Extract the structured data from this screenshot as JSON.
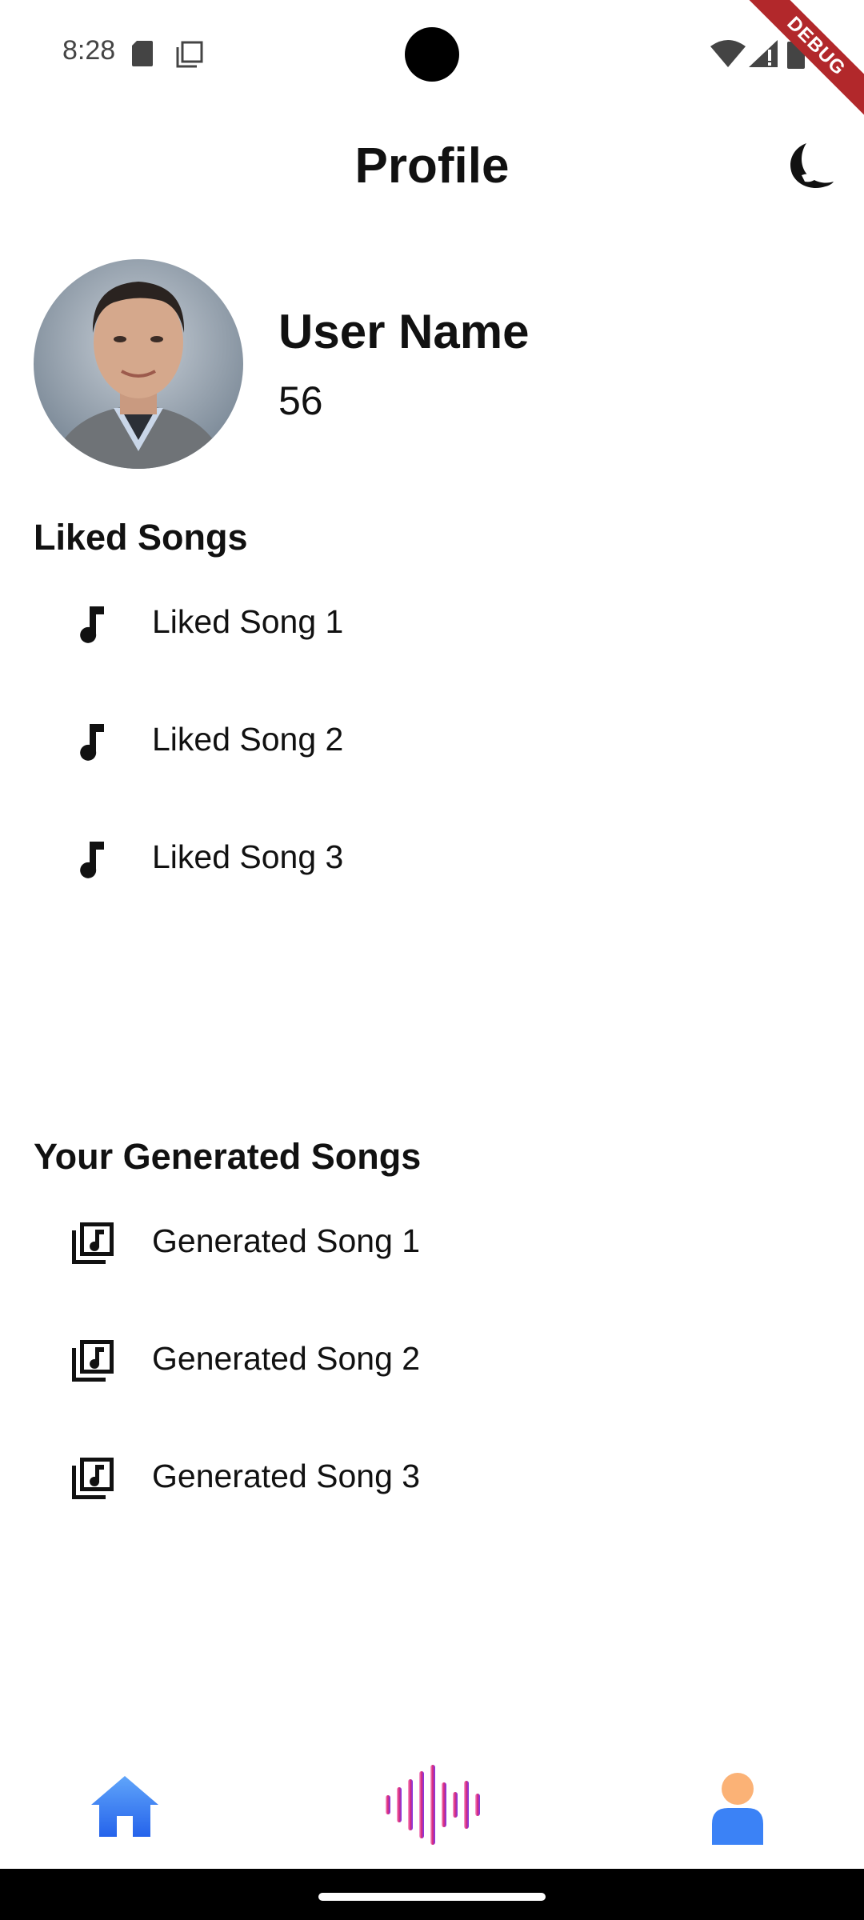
{
  "status_bar": {
    "time": "8:28"
  },
  "debug_banner": {
    "label": "DEBUG"
  },
  "header": {
    "title": "Profile",
    "theme_icon": "moon-icon"
  },
  "profile": {
    "user_name": "User Name",
    "count": "56"
  },
  "liked_songs": {
    "title": "Liked Songs",
    "icon": "music-note-icon",
    "items": [
      {
        "label": "Liked Song 1"
      },
      {
        "label": "Liked Song 2"
      },
      {
        "label": "Liked Song 3"
      }
    ]
  },
  "generated_songs": {
    "title": "Your Generated Songs",
    "icon": "library-music-icon",
    "items": [
      {
        "label": "Generated Song 1"
      },
      {
        "label": "Generated Song 2"
      },
      {
        "label": "Generated Song 3"
      }
    ]
  },
  "bottom_nav": {
    "items": [
      {
        "icon": "home-icon",
        "color": "#3b82f6"
      },
      {
        "icon": "soundwave-icon",
        "color": "#c026d3"
      },
      {
        "icon": "person-icon",
        "color": "#3b82f6"
      }
    ]
  },
  "colors": {
    "accent_blue": "#3b82f6",
    "wave_pink": "#f472b6",
    "wave_purple": "#7c3aed",
    "debug_red": "#b2282b"
  }
}
